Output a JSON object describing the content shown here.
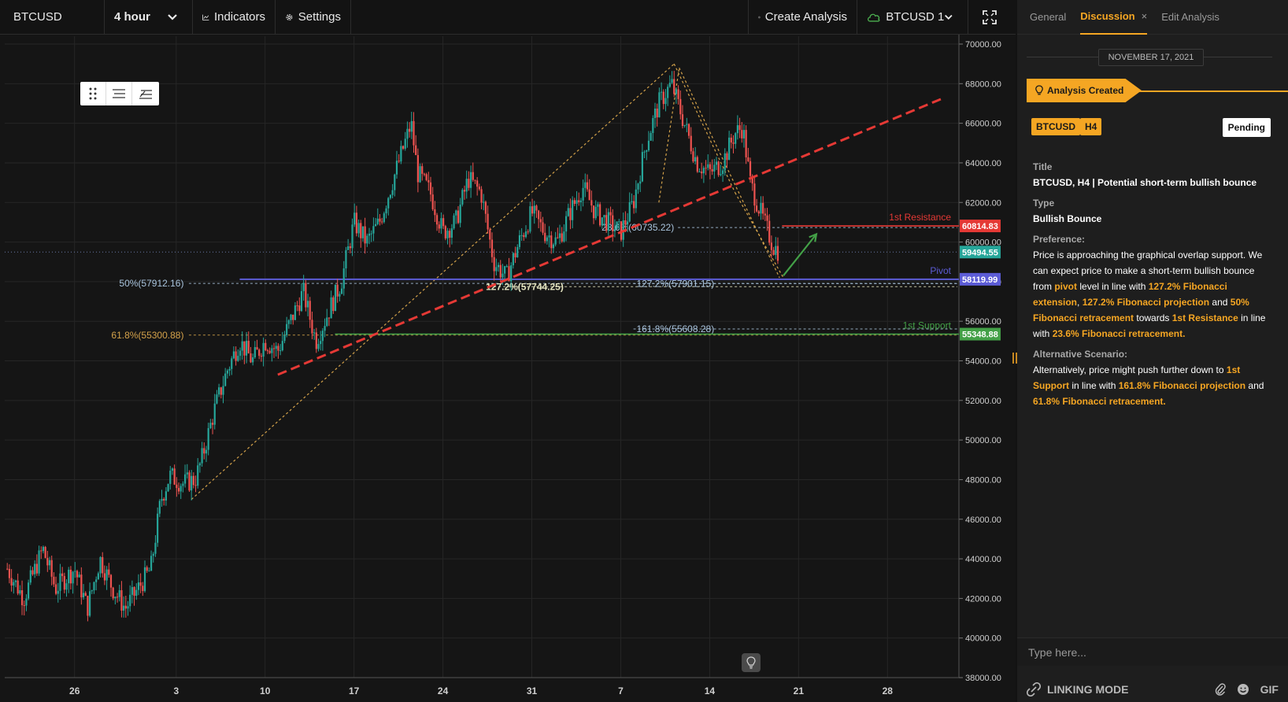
{
  "toolbar": {
    "symbol": "BTCUSD",
    "interval": "4 hour",
    "indicators_label": "Indicators",
    "settings_label": "Settings",
    "create_analysis_label": "Create Analysis",
    "watch_label": "BTCUSD 1"
  },
  "colors": {
    "background": "#151515",
    "panel": "#1e1e1e",
    "accent": "#f5a623",
    "candle_up": "#26a69a",
    "candle_down": "#ef5350",
    "resistance": "#e53935",
    "support": "#43a047",
    "pivot": "#5c5cd6",
    "price_tag": "#26a69a"
  },
  "chart_data": {
    "type": "candlestick",
    "symbol": "BTCUSD",
    "interval": "4 hour",
    "y_ticks": [
      "70000.00",
      "68000.00",
      "66000.00",
      "64000.00",
      "62000.00",
      "60000.00",
      "58000.00",
      "56000.00",
      "54000.00",
      "52000.00",
      "50000.00",
      "48000.00",
      "46000.00",
      "44000.00",
      "42000.00",
      "40000.00",
      "38000.00"
    ],
    "ylim": [
      38000,
      70000
    ],
    "x_ticks": [
      {
        "day": 0,
        "label": "26"
      },
      {
        "day": 8,
        "label": "3"
      },
      {
        "day": 15,
        "label": "10"
      },
      {
        "day": 22,
        "label": "17"
      },
      {
        "day": 29,
        "label": "24"
      },
      {
        "day": 36,
        "label": "31"
      },
      {
        "day": 43,
        "label": "7"
      },
      {
        "day": 50,
        "label": "14"
      },
      {
        "day": 57,
        "label": "21"
      },
      {
        "day": 64,
        "label": "28"
      }
    ],
    "xlim": [
      -5.5,
      69.5
    ],
    "price_path": [
      [
        -5.3,
        43500
      ],
      [
        -4,
        42000
      ],
      [
        -2.5,
        44500
      ],
      [
        -1.5,
        42500
      ],
      [
        0,
        43500
      ],
      [
        1,
        41500
      ],
      [
        2,
        44000
      ],
      [
        3,
        42500
      ],
      [
        4,
        41500
      ],
      [
        5,
        42500
      ],
      [
        6,
        43500
      ],
      [
        6.8,
        47000
      ],
      [
        7.5,
        48200
      ],
      [
        8.5,
        47800
      ],
      [
        9.5,
        48000
      ],
      [
        10,
        49000
      ],
      [
        11,
        51500
      ],
      [
        12,
        53500
      ],
      [
        13,
        55000
      ],
      [
        14,
        54000
      ],
      [
        15,
        55000
      ],
      [
        16,
        54500
      ],
      [
        17,
        56000
      ],
      [
        18,
        57500
      ],
      [
        19,
        55000
      ],
      [
        20,
        56500
      ],
      [
        21,
        58000
      ],
      [
        22,
        61000
      ],
      [
        23,
        60000
      ],
      [
        24,
        61000
      ],
      [
        25,
        63000
      ],
      [
        26,
        65000
      ],
      [
        26.5,
        66000
      ],
      [
        27,
        63500
      ],
      [
        28,
        62500
      ],
      [
        29,
        60500
      ],
      [
        30,
        61000
      ],
      [
        31,
        63200
      ],
      [
        32,
        62500
      ],
      [
        33,
        59000
      ],
      [
        34,
        58200
      ],
      [
        35,
        60000
      ],
      [
        36,
        61500
      ],
      [
        37,
        60500
      ],
      [
        38,
        60000
      ],
      [
        39,
        61500
      ],
      [
        40,
        62800
      ],
      [
        41,
        61500
      ],
      [
        42,
        61000
      ],
      [
        43,
        60500
      ],
      [
        44,
        62000
      ],
      [
        45,
        65000
      ],
      [
        46,
        67000
      ],
      [
        47,
        68000
      ],
      [
        48,
        66000
      ],
      [
        49,
        64000
      ],
      [
        50,
        63500
      ],
      [
        51,
        64000
      ],
      [
        52,
        65500
      ],
      [
        52.6,
        65800
      ],
      [
        53.2,
        63000
      ],
      [
        54,
        61500
      ],
      [
        55,
        59800
      ],
      [
        55.5,
        59500
      ]
    ],
    "last_price": 59494.55,
    "levels": [
      {
        "name": "1st Resistance",
        "value": 60814.83,
        "label": "60814.83"
      },
      {
        "name": "Pivot",
        "value": 58119.99,
        "label": "58119.99"
      },
      {
        "name": "1st Support",
        "value": 55348.88,
        "label": "55348.88"
      }
    ],
    "last_price_label": "59494.55",
    "fib_labels": [
      {
        "text": "23.6%(60735.22)",
        "value": 60735.22
      },
      {
        "text": "50%(57912.16)",
        "value": 57912.16
      },
      {
        "text": "61.8%(55300.88)",
        "value": 55300.88
      },
      {
        "text": "127.2%(57744.25)",
        "value": 57744.25
      },
      {
        "text": "127.2%(57901.15)",
        "value": 57901.15
      },
      {
        "text": "161.8%(55608.28)",
        "value": 55608.28
      }
    ],
    "trendline": {
      "from": [
        16,
        53300
      ],
      "to": [
        68.5,
        67300
      ]
    },
    "arrow": {
      "from": [
        55.8,
        58300
      ],
      "to": [
        58.4,
        60400
      ]
    }
  },
  "panel": {
    "tabs": [
      "General",
      "Discussion",
      "Edit Analysis"
    ],
    "close_glyph": "×",
    "date": "NOVEMBER 17, 2021",
    "created_label": "Analysis Created",
    "badge_symbol": "BTCUSD",
    "badge_tf": "H4",
    "status": "Pending",
    "title_label": "Title",
    "title": "BTCUSD, H4 | Potential short-term bullish bounce",
    "type_label": "Type",
    "type": "Bullish Bounce",
    "preference_label": "Preference:",
    "preference": [
      {
        "t": "Price is approaching the graphical overlap support. We can expect price to make a short-term bullish bounce from ",
        "h": false
      },
      {
        "t": "pivot",
        "h": true
      },
      {
        "t": " level in line with ",
        "h": false
      },
      {
        "t": "127.2% Fibonacci extension",
        "h": true
      },
      {
        "t": ", ",
        "h": false
      },
      {
        "t": "127.2% Fibonacci projection",
        "h": true
      },
      {
        "t": " and ",
        "h": false
      },
      {
        "t": "50% Fibonacci retracement",
        "h": true
      },
      {
        "t": " towards ",
        "h": false
      },
      {
        "t": "1st Resistance",
        "h": true
      },
      {
        "t": " in line with ",
        "h": false
      },
      {
        "t": "23.6% Fibonacci retracement.",
        "h": true
      }
    ],
    "alternative_label": "Alternative Scenario:",
    "alternative": [
      {
        "t": "Alternatively, price might push further down to ",
        "h": false
      },
      {
        "t": "1st Support",
        "h": true
      },
      {
        "t": " in line with ",
        "h": false
      },
      {
        "t": "161.8% Fibonacci projection",
        "h": true
      },
      {
        "t": " and ",
        "h": false
      },
      {
        "t": "61.8% Fibonacci retracement.",
        "h": true
      }
    ],
    "message_placeholder": "Type here...",
    "linking_label": "LINKING MODE",
    "gif_label": "GIF"
  }
}
